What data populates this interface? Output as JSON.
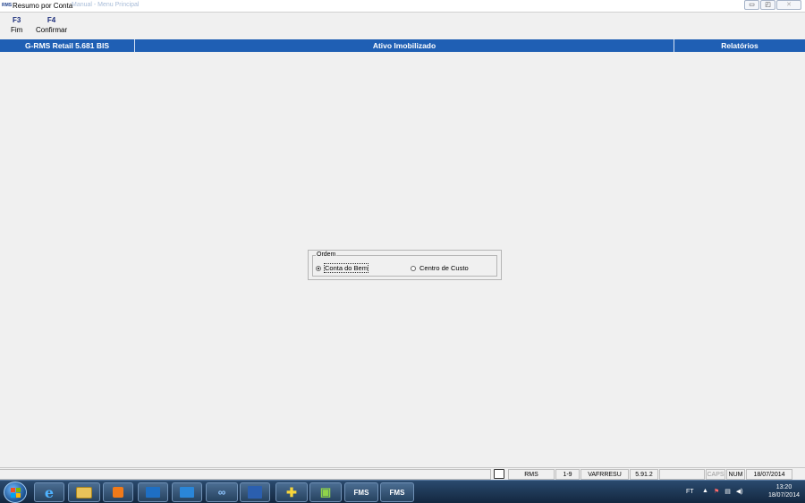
{
  "window": {
    "logo": "RMS",
    "title": "Resumo por Conta",
    "subtitle": "Manual - Menu Principal",
    "controls": {
      "minimize": "▭",
      "restore": "◰",
      "close": "✕"
    }
  },
  "toolbar": {
    "f3": {
      "key": "F3",
      "label": "Fim"
    },
    "f4": {
      "key": "F4",
      "label": "Confirmar"
    }
  },
  "header": {
    "system": "G-RMS Retail 5.681 BIS",
    "module": "Ativo Imobilizado",
    "section": "Relatórios"
  },
  "ordem": {
    "legend": "Ordem",
    "options": [
      {
        "label": "Conta do Bem",
        "selected": true
      },
      {
        "label": "Centro de Custo",
        "selected": false
      }
    ]
  },
  "statusbar": {
    "icon": "document-icon",
    "rms": "RMS",
    "range": "1-9",
    "program": "VAFRRESU",
    "version": "5.91.2",
    "empty": "",
    "caps": "CAPS",
    "num": "NUM",
    "date": "18/07/2014"
  },
  "taskbar": {
    "apps": [
      "ie-icon",
      "explorer-icon",
      "media-player-icon",
      "outlook-icon",
      "lync-icon",
      "connect-icon",
      "word-icon",
      "app-icon",
      "app-icon-2",
      "FMS",
      "FMS"
    ],
    "tray_text": "FT",
    "time": "13:20",
    "date": "18/07/2014"
  },
  "colors": {
    "accent_bar": "#1f5fb4",
    "key_text": "#1a2c7a"
  }
}
